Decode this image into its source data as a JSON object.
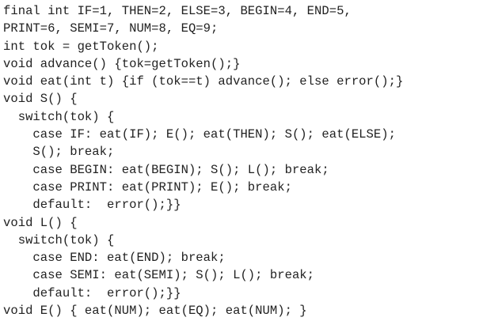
{
  "code": {
    "lines": [
      "final int IF=1, THEN=2, ELSE=3, BEGIN=4, END=5,",
      "PRINT=6, SEMI=7, NUM=8, EQ=9;",
      "int tok = getToken();",
      "void advance() {tok=getToken();}",
      "void eat(int t) {if (tok==t) advance(); else error();}",
      "void S() {",
      "  switch(tok) {",
      "    case IF: eat(IF); E(); eat(THEN); S(); eat(ELSE);",
      "    S(); break;",
      "    case BEGIN: eat(BEGIN); S(); L(); break;",
      "    case PRINT: eat(PRINT); E(); break;",
      "    default:  error();}}",
      "void L() {",
      "  switch(tok) {",
      "    case END: eat(END); break;",
      "    case SEMI: eat(SEMI); S(); L(); break;",
      "    default:  error();}}",
      "void E() { eat(NUM); eat(EQ); eat(NUM); }"
    ]
  }
}
